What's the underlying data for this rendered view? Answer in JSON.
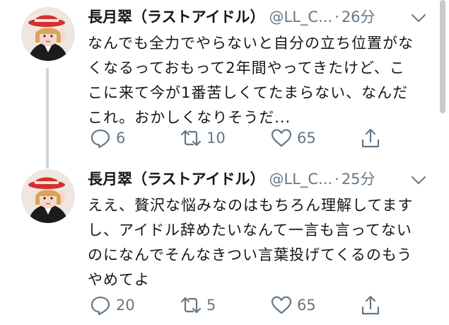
{
  "colors": {
    "text": "#14171a",
    "secondary": "#657786",
    "thread_line": "#ccd6dd",
    "background": "#ffffff"
  },
  "tweets": [
    {
      "display_name": "長月翠（ラストアイドル）",
      "handle": "@LL_C...",
      "separator": "·",
      "time": "26分",
      "text_lines": [
        "なんでも全力でやらないと自分の立ち位置がな",
        "くなるっておもって2年間やってきたけど、こ",
        "こに来て今が1番苦しくてたまらない、なんだ",
        "これ。おかしくなりそうだ..."
      ],
      "reply_count": "6",
      "retweet_count": "10",
      "like_count": "65",
      "icons": [
        "reply-icon",
        "retweet-icon",
        "like-icon",
        "share-icon",
        "chevron-down-icon"
      ]
    },
    {
      "display_name": "長月翠（ラストアイドル）",
      "handle": "@LL_C...",
      "separator": "·",
      "time": "25分",
      "text_lines": [
        "ええ、贅沢な悩みなのはもちろん理解してます",
        "し、アイドル辞めたいなんて一言も言ってない",
        "のになんでそんなきつい言葉投げてくるのもう",
        "やめてよ"
      ],
      "reply_count": "20",
      "retweet_count": "5",
      "like_count": "65",
      "icons": [
        "reply-icon",
        "retweet-icon",
        "like-icon",
        "share-icon",
        "chevron-down-icon"
      ]
    }
  ]
}
